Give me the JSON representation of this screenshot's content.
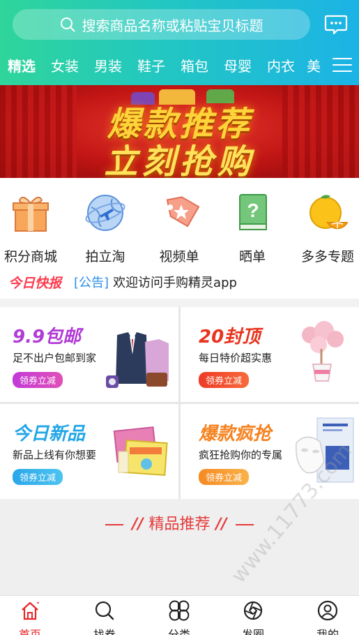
{
  "search": {
    "placeholder": "搜索商品名称或粘贴宝贝标题"
  },
  "tabs": [
    "精选",
    "女装",
    "男装",
    "鞋子",
    "箱包",
    "母婴",
    "内衣",
    "美"
  ],
  "banner": {
    "line1": "爆款推荐",
    "line2": "立刻抢购"
  },
  "categories": [
    {
      "label": "积分商城",
      "icon": "gift-box-icon"
    },
    {
      "label": "拍立淘",
      "icon": "globe-plane-icon"
    },
    {
      "label": "视频单",
      "icon": "video-tag-icon"
    },
    {
      "label": "晒单",
      "icon": "question-book-icon"
    },
    {
      "label": "多多专题",
      "icon": "orange-fruit-icon"
    }
  ],
  "news": {
    "brand": "今日快报",
    "tag": "[公告]",
    "text": "欢迎访问手购精灵app"
  },
  "promos": [
    {
      "title": "9.9包邮",
      "sub": "足不出户包邮到家",
      "btn": "领券立减",
      "color": "#b13bd6",
      "btnColor": "#c23ad8"
    },
    {
      "title": "20封顶",
      "sub": "每日特价超实惠",
      "btn": "领券立减",
      "color": "#e8331e",
      "btnColor": "#ee3a26"
    },
    {
      "title": "今日新品",
      "sub": "新品上线有你想要",
      "btn": "领券立减",
      "color": "#21a6e6",
      "btnColor": "#2aa7ea"
    },
    {
      "title": "爆款疯抢",
      "sub": "疯狂抢购你的专属",
      "btn": "领券立减",
      "color": "#f5821f",
      "btnColor": "#f58a22"
    }
  ],
  "section": {
    "title": "精品推荐"
  },
  "watermark": "www.11773.com",
  "bottom_nav": [
    {
      "label": "首页",
      "icon": "home-icon",
      "active": true
    },
    {
      "label": "找券",
      "icon": "search-icon",
      "active": false
    },
    {
      "label": "分类",
      "icon": "category-icon",
      "active": false
    },
    {
      "label": "发圈",
      "icon": "aperture-icon",
      "active": false
    },
    {
      "label": "我的",
      "icon": "profile-icon",
      "active": false
    }
  ]
}
